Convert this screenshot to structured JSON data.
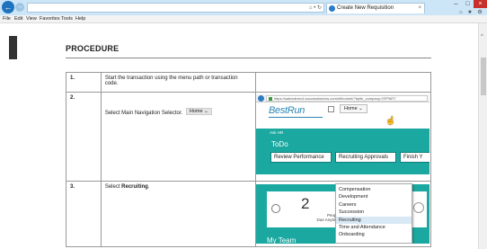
{
  "browser": {
    "address": "",
    "address_controls": "⌂ • ↻",
    "tab_title": "Create New Requisition",
    "tab_close": "×",
    "back_glyph": "←",
    "forward_glyph": "→",
    "window_controls": {
      "min": "–",
      "max": "□",
      "close": "×"
    },
    "toolbar_icons": "⌂ ★ ⚙",
    "menu": [
      "File",
      "Edit",
      "View",
      "Favorites",
      "Tools",
      "Help"
    ]
  },
  "doc": {
    "title": "PROCEDURE",
    "steps": [
      {
        "num": "1.",
        "text": "Start the transaction using the menu path or transaction code."
      },
      {
        "num": "2.",
        "text_before": "Select Main Navigation Selector.",
        "pill": "Home ⌄"
      },
      {
        "num": "3.",
        "text_before": "Select ",
        "bold": "Recruiting",
        "text_after": "."
      }
    ]
  },
  "shot1": {
    "url": "https://salesdemo4.successfactors.com/sf/home#/?bplte_company=SFPART",
    "logo": "BestRun",
    "home_menu": "Home ⌄",
    "ask_hr": "Ask HR",
    "todo": "ToDo",
    "tiles": [
      "Review Performance",
      "Recruiting Approvals",
      "Finish Y"
    ]
  },
  "shot2": {
    "big_number": "2",
    "people_line1": "People",
    "people_line2": "Due Anytime",
    "my_team": "My Team",
    "menu_items": [
      "Compensation",
      "Development",
      "Careers",
      "Succession",
      "Recruiting",
      "Time and Attendance",
      "Onboarding"
    ],
    "selected_item": "Recruiting"
  },
  "colors": {
    "teal": "#1aa8a0",
    "ie_blue": "#1e73be",
    "titlebar": "#cde6f7"
  }
}
